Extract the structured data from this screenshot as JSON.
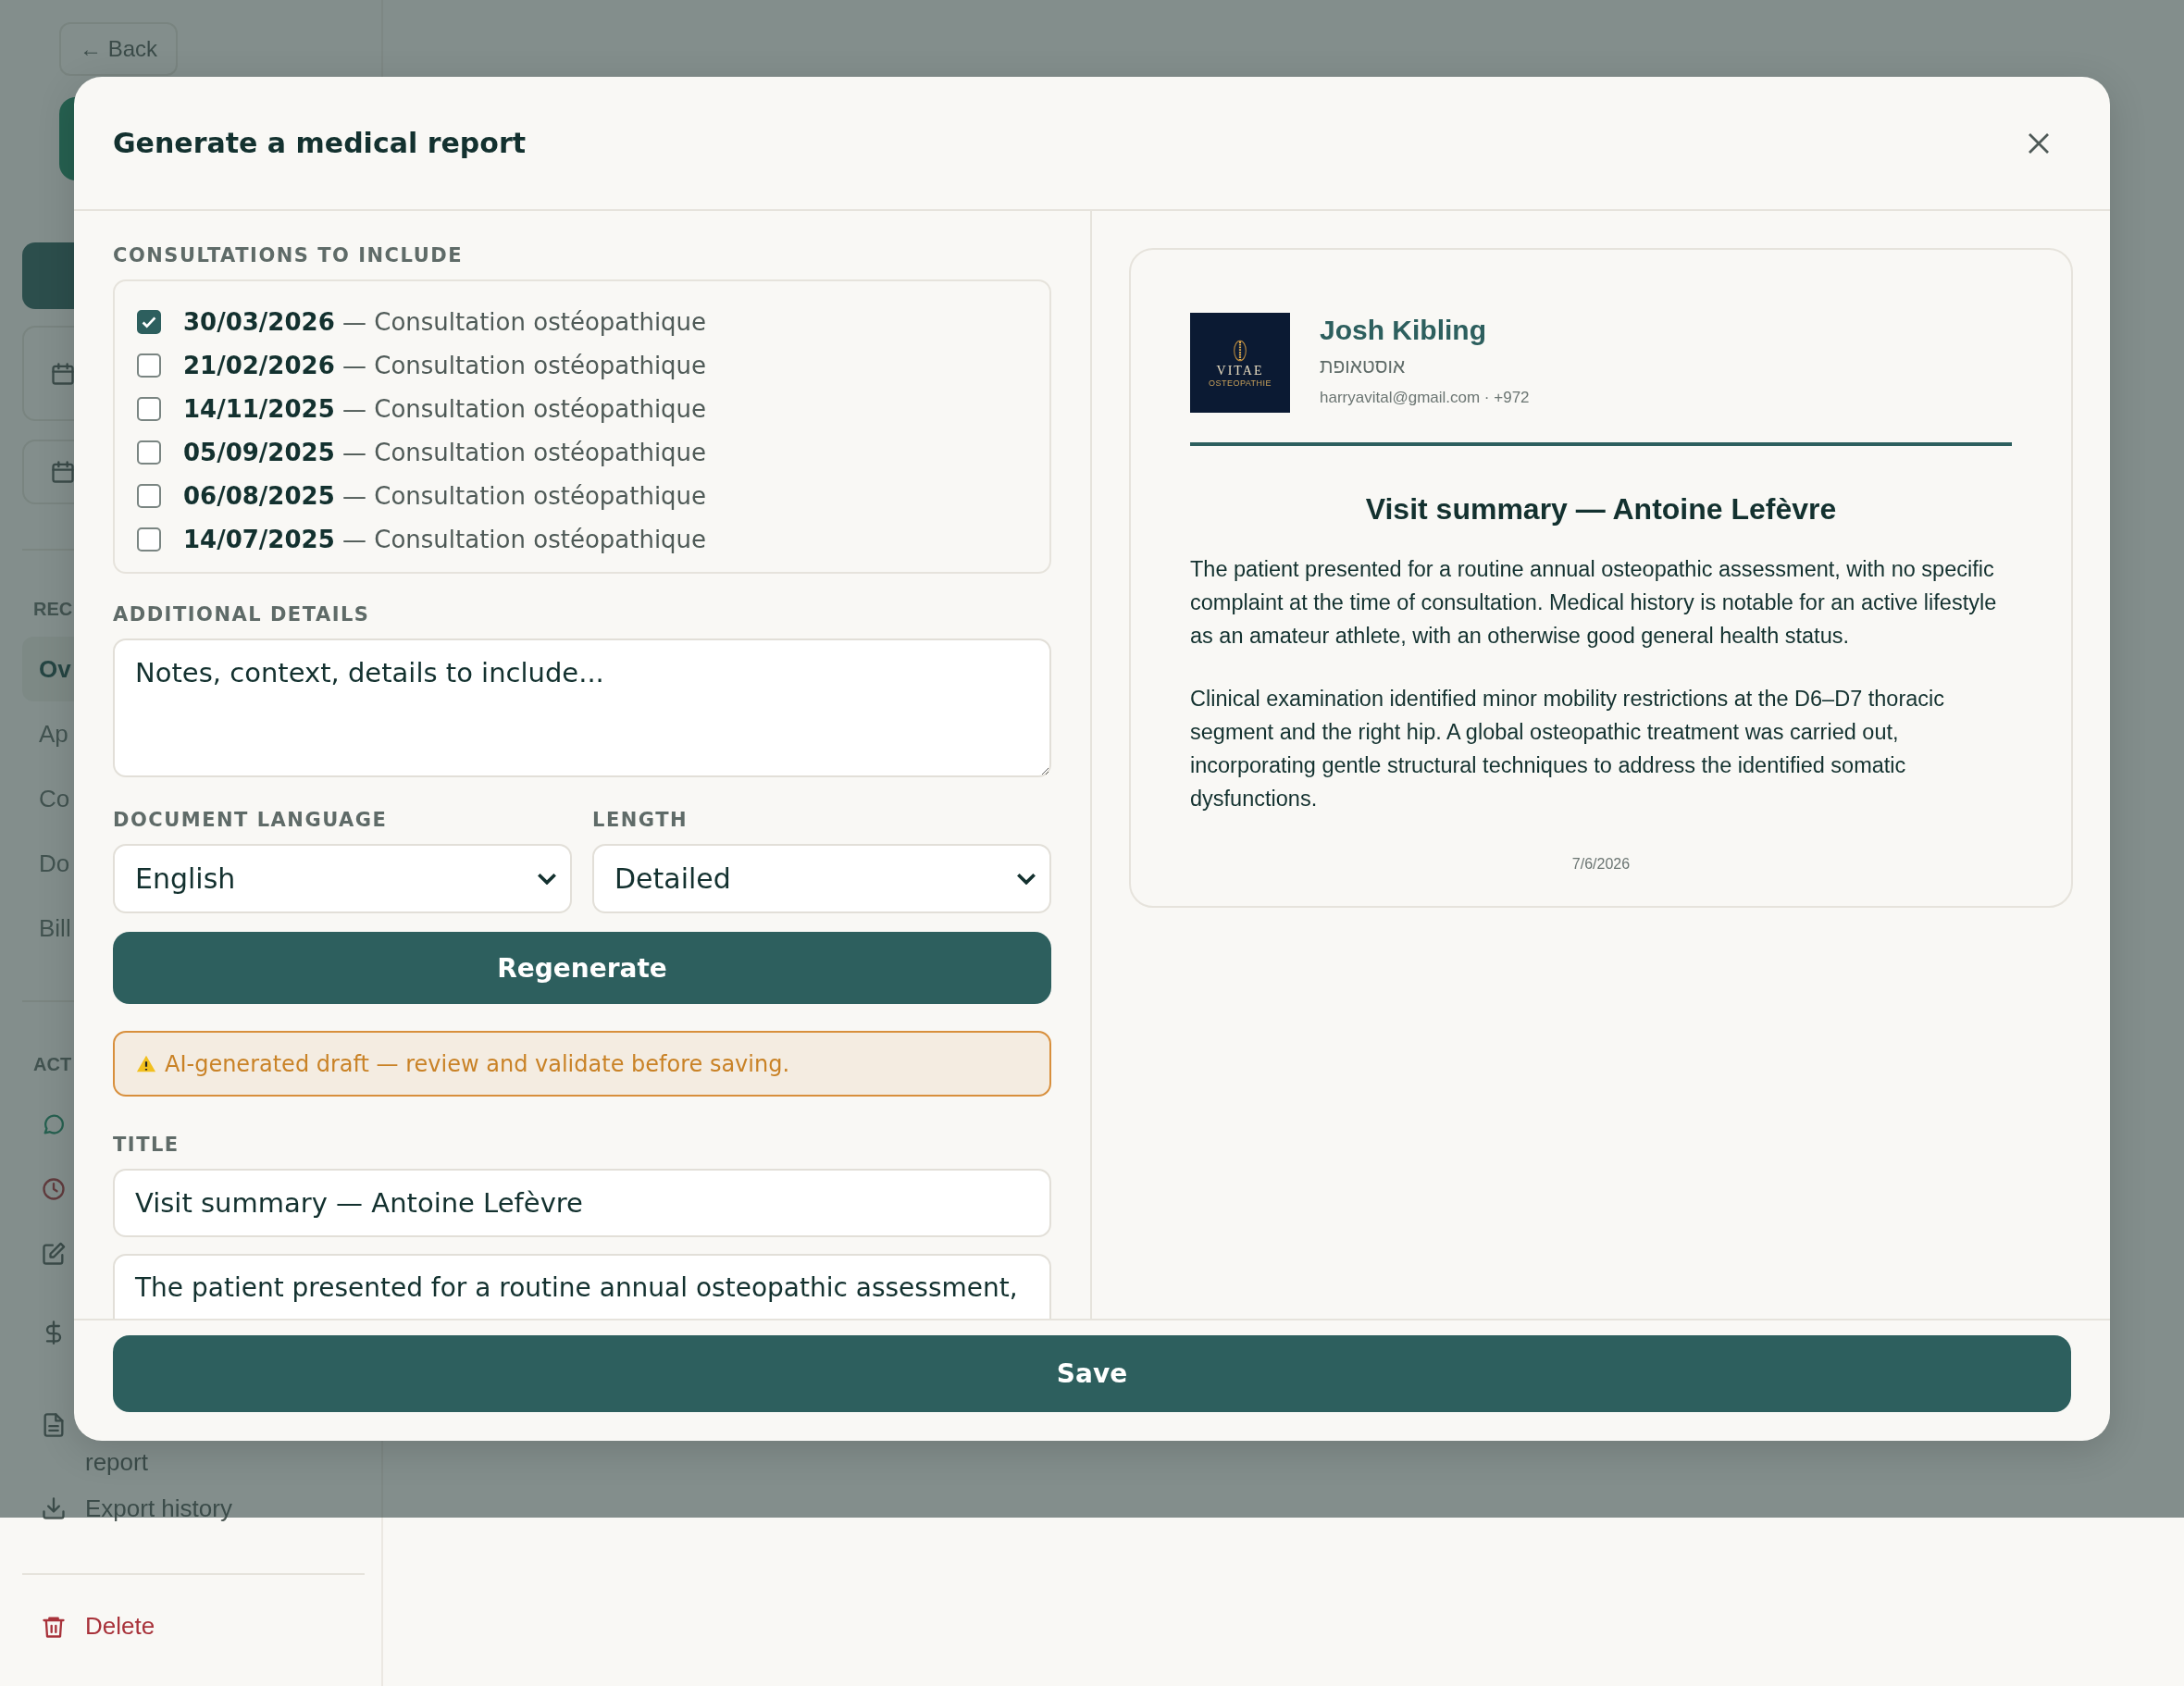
{
  "background": {
    "back_button": "← Back",
    "records_label": "REC",
    "nav_items": [
      {
        "label": "Ov",
        "selected": true
      },
      {
        "label": "Ap",
        "selected": false
      },
      {
        "label": "Co",
        "selected": false
      },
      {
        "label": "Do",
        "selected": false
      },
      {
        "label": "Bill",
        "selected": false
      }
    ],
    "actions_label": "ACT",
    "actions": [
      {
        "kind": "chat"
      },
      {
        "kind": "clock"
      },
      {
        "kind": "edit"
      },
      {
        "kind": "dollar"
      },
      {
        "kind": "document",
        "label": "report"
      },
      {
        "kind": "download",
        "label": "Export history"
      }
    ],
    "delete": "Delete"
  },
  "modal": {
    "title": "Generate a medical report",
    "consultations_label": "CONSULTATIONS TO INCLUDE",
    "consultations": [
      {
        "date": "30/03/2026",
        "type": "— Consultation ostéopathique",
        "checked": true
      },
      {
        "date": "21/02/2026",
        "type": "— Consultation ostéopathique",
        "checked": false
      },
      {
        "date": "14/11/2025",
        "type": "— Consultation ostéopathique",
        "checked": false
      },
      {
        "date": "05/09/2025",
        "type": "— Consultation ostéopathique",
        "checked": false
      },
      {
        "date": "06/08/2025",
        "type": "— Consultation ostéopathique",
        "checked": false
      },
      {
        "date": "14/07/2025",
        "type": "— Consultation ostéopathique",
        "checked": false
      }
    ],
    "details_label": "ADDITIONAL DETAILS",
    "details_placeholder": "Notes, context, details to include...",
    "language_label": "DOCUMENT LANGUAGE",
    "language": "English",
    "length_label": "LENGTH",
    "length": "Detailed",
    "regenerate_button": "Regenerate",
    "warning": "AI-generated draft — review and validate before saving.",
    "title_label": "TITLE",
    "title_value": "Visit summary — Antoine Lefèvre",
    "body_value": "The patient presented for a routine annual osteopathic assessment,",
    "save_button": "Save",
    "preview": {
      "logo": {
        "name": "VITAE",
        "subtitle": "OSTEOPATHIE"
      },
      "practitioner": "Josh Kibling",
      "specialty": "אוסטאופת",
      "contact": "harryavital@gmail.com · +972",
      "heading": "Visit summary — Antoine Lefèvre",
      "paragraphs": [
        "The patient presented for a routine annual osteopathic assessment, with no specific complaint at the time of consultation. Medical history is notable for an active lifestyle as an amateur athlete, with an otherwise good general health status.",
        "Clinical examination identified minor mobility restrictions at the D6–D7 thoracic segment and the right hip. A global osteopathic treatment was carried out, incorporating gentle structural techniques to address the identified somatic dysfunctions."
      ],
      "date": "7/6/2026"
    }
  }
}
